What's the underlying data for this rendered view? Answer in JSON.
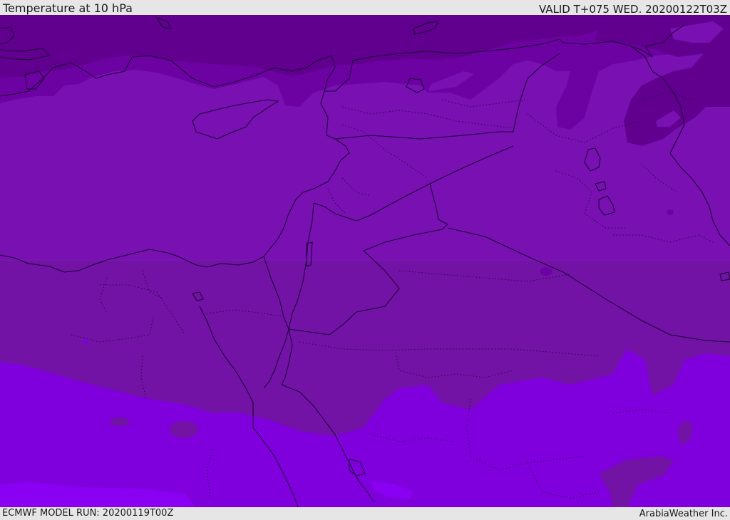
{
  "header": {
    "title": "Temperature at 10 hPa",
    "valid": "VALID T+075 WED. 20200122T03Z"
  },
  "footer": {
    "model_run": "ECMWF MODEL RUN: 20200119T00Z",
    "credit": "ArabiaWeather Inc."
  },
  "legend_colors": {
    "darkest_purple": "#61008f",
    "dark_purple": "#6d02a3",
    "mid_purple": "#7810b2",
    "muted_purple": "#7213a6",
    "violet": "#7f00dc",
    "bright_violet": "#8a00f2",
    "blue_violet": "#6e1bff"
  },
  "map": {
    "layers": [
      "temperature-contour-fill",
      "coastlines",
      "country-borders",
      "province-borders"
    ]
  }
}
